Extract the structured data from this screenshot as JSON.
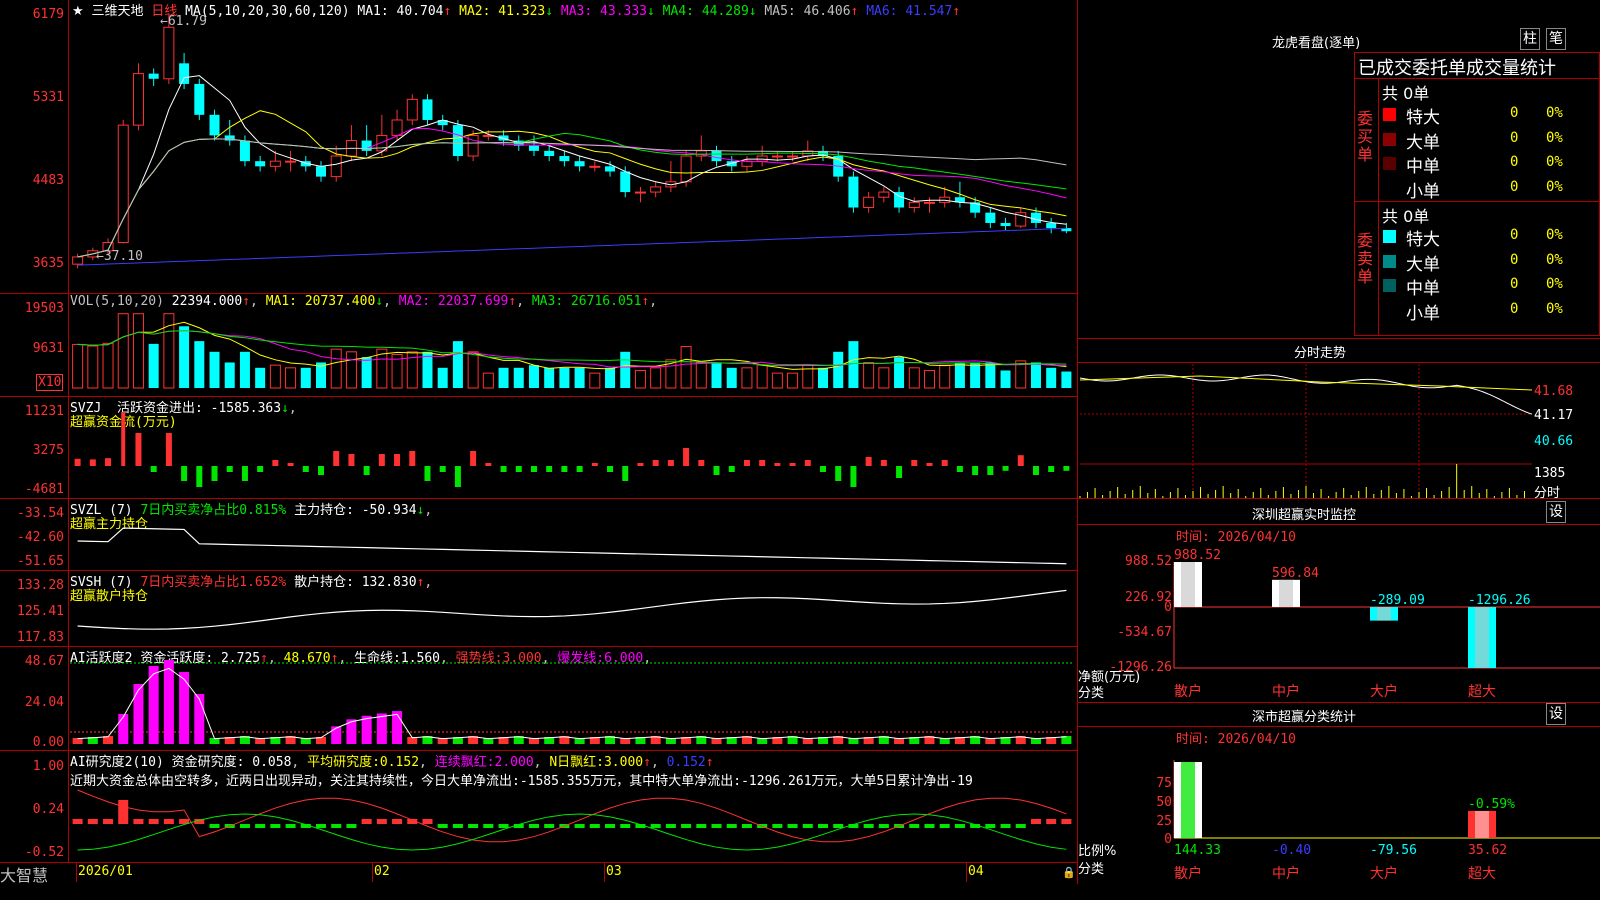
{
  "window": {
    "app_name": "大智慧"
  },
  "main": {
    "title": "三维天地",
    "period": "日线",
    "ma_label": "MA(5,10,20,30,60,120)",
    "ma": [
      {
        "label": "MA1:",
        "value": "40.704",
        "arrow": "↑",
        "color": "#ffffff"
      },
      {
        "label": "MA2:",
        "value": "41.323",
        "arrow": "↓",
        "color": "#ffff00"
      },
      {
        "label": "MA3:",
        "value": "43.333",
        "arrow": "↓",
        "color": "#ff00ff"
      },
      {
        "label": "MA4:",
        "value": "44.289",
        "arrow": "↓",
        "color": "#00e600"
      },
      {
        "label": "MA5:",
        "value": "46.406",
        "arrow": "↑",
        "color": "#c0c0c0"
      },
      {
        "label": "MA6:",
        "value": "41.547",
        "arrow": "↑",
        "color": "#3c3cff"
      }
    ],
    "high_note": "61.79",
    "low_note": "37.10",
    "y_ticks": [
      "6179",
      "5331",
      "4483",
      "3635"
    ],
    "x_ticks": [
      "2026/01",
      "02",
      "03",
      "04"
    ]
  },
  "vol": {
    "label": "VOL(5,10,20)",
    "value": "22394.000",
    "ma": [
      {
        "label": "MA1:",
        "value": "20737.400",
        "arrow": "↓",
        "color": "#ffff00"
      },
      {
        "label": "MA2:",
        "value": "22037.699",
        "arrow": "↑",
        "color": "#ff00ff"
      },
      {
        "label": "MA3:",
        "value": "26716.051",
        "arrow": "↑",
        "color": "#00e600"
      }
    ],
    "y_ticks": [
      "19503",
      "9631"
    ],
    "unit": "X10"
  },
  "svzj": {
    "label": "SVZJ",
    "desc": "活跃资金进出:",
    "value": "-1585.363",
    "sub": "超赢资金流(万元)",
    "y_ticks": [
      "11231",
      "3275",
      "-4681"
    ]
  },
  "svzl": {
    "label": "SVZL (7)",
    "desc1": "7日内买卖净占比0.815%",
    "desc2": "主力持仓:",
    "value": "-50.934",
    "sub": "超赢主力持仓",
    "y_ticks": [
      "-33.54",
      "-42.60",
      "-51.65"
    ]
  },
  "svsh": {
    "label": "SVSH (7)",
    "desc1": "7日内买卖净占比1.652%",
    "desc2": "散户持仓:",
    "value": "132.830",
    "sub": "超赢散户持仓",
    "y_ticks": [
      "133.28",
      "125.41",
      "117.83"
    ]
  },
  "ai1": {
    "label": "AI活跃度2",
    "desc": "资金活跃度:",
    "v1": "2.725",
    "v2": "48.670",
    "life_label": "生命线:",
    "life": "1.560",
    "strong_label": "强势线:",
    "strong": "3.000",
    "burst_label": "爆发线:",
    "burst": "6.000",
    "y_ticks": [
      "48.67",
      "24.04",
      "0.00"
    ]
  },
  "ai2": {
    "label": "AI研究度2(10)",
    "desc": "资金研究度:",
    "v1": "0.058",
    "avg_label": "平均研究度:",
    "avg": "0.152",
    "red_label": "连续飘红:",
    "red": "2.000",
    "n_label": "N日飘红:",
    "n": "3.000",
    "v5": "0.152",
    "text": "近期大资金总体由空转多，近两日出现异动，关注其持续性，今日大单净流出:-1585.355万元，其中特大单净流出:-1296.261万元，大单5日累计净出-19",
    "y_ticks": [
      "1.00",
      "0.24",
      "-0.52"
    ]
  },
  "longhu": {
    "title": "龙虎看盘(逐单)",
    "btn1": "柱",
    "btn2": "笔",
    "header": "已成交委托单成交量统计",
    "buy_label": "委买单",
    "sell_label": "委卖单",
    "buy_total": "共 0单",
    "sell_total": "共 0单",
    "buy_rows": [
      {
        "name": "特大",
        "qty": "0",
        "pct": "0%",
        "color": "#ff0000"
      },
      {
        "name": "大单",
        "qty": "0",
        "pct": "0%",
        "color": "#8b0000"
      },
      {
        "name": "中单",
        "qty": "0",
        "pct": "0%",
        "color": "#5a0000"
      },
      {
        "name": "小单",
        "qty": "0",
        "pct": "0%",
        "color": "#000000"
      }
    ],
    "sell_rows": [
      {
        "name": "特大",
        "qty": "0",
        "pct": "0%",
        "color": "#00ffff"
      },
      {
        "name": "大单",
        "qty": "0",
        "pct": "0%",
        "color": "#008b8b"
      },
      {
        "name": "中单",
        "qty": "0",
        "pct": "0%",
        "color": "#006060"
      },
      {
        "name": "小单",
        "qty": "0",
        "pct": "0%",
        "color": "#000000"
      }
    ]
  },
  "intraday": {
    "title": "分时走势",
    "y_ticks": [
      "41.68",
      "41.17",
      "40.66"
    ],
    "vol_tick": "1385",
    "vol_label": "分时"
  },
  "sz_monitor": {
    "title": "深圳超赢实时监控",
    "set": "设",
    "date": "时间: 2026/04/10",
    "y_ticks": [
      "988.52",
      "226.92",
      "0",
      "-534.67",
      "-1296.26"
    ],
    "ylabel": "净额(万元)",
    "xlabel": "分类",
    "categories": [
      "散户",
      "中户",
      "大户",
      "超大"
    ],
    "values": [
      988.52,
      596.84,
      -289.09,
      -1296.26
    ],
    "value_labels": [
      "988.52",
      "596.84",
      "-289.09",
      "-1296.26"
    ]
  },
  "sz_class": {
    "title": "深市超赢分类统计",
    "set": "设",
    "date": "时间: 2026/04/10",
    "y_ticks": [
      "75",
      "50",
      "25",
      "0"
    ],
    "ylabel": "比例%",
    "xlabel": "分类",
    "categories": [
      "散户",
      "中户",
      "大户",
      "超大"
    ],
    "values": [
      144.33,
      -0.4,
      -79.56,
      35.62
    ],
    "value_labels": [
      "144.33",
      "-0.40",
      "-79.56",
      "35.62"
    ],
    "top_note": "-0.59%"
  },
  "chart_data": [
    {
      "type": "candlestick",
      "title": "三维天地 日线",
      "ylim": [
        36.35,
        61.79
      ],
      "x": [
        "2026/01",
        "02",
        "03",
        "04"
      ],
      "candles": [
        [
          37.5,
          38.2,
          37.1,
          38.5
        ],
        [
          38.2,
          38.8,
          37.9,
          39.1
        ],
        [
          38.8,
          39.6,
          38.5,
          40.0
        ],
        [
          39.6,
          51.0,
          39.5,
          51.5
        ],
        [
          51.0,
          56.0,
          50.5,
          57.0
        ],
        [
          56.0,
          55.5,
          54.8,
          56.5
        ],
        [
          55.5,
          60.5,
          55.0,
          61.79
        ],
        [
          57.0,
          55.0,
          54.5,
          58.0
        ],
        [
          55.0,
          52.0,
          51.5,
          55.5
        ],
        [
          52.0,
          50.0,
          49.5,
          52.5
        ],
        [
          50.0,
          49.5,
          49.0,
          51.5
        ],
        [
          49.5,
          47.5,
          47.0,
          50.0
        ],
        [
          47.5,
          47.0,
          46.5,
          48.0
        ],
        [
          47.0,
          47.5,
          46.5,
          48.5
        ],
        [
          47.5,
          47.5,
          46.5,
          48.5
        ],
        [
          47.5,
          47.0,
          46.5,
          48.0
        ],
        [
          47.0,
          46.0,
          45.5,
          47.5
        ],
        [
          46.0,
          48.0,
          45.5,
          49.0
        ],
        [
          48.0,
          49.5,
          47.5,
          51.0
        ],
        [
          49.5,
          48.5,
          48.0,
          51.0
        ],
        [
          48.5,
          50.0,
          48.0,
          52.0
        ],
        [
          50.0,
          51.5,
          49.5,
          52.5
        ],
        [
          51.5,
          53.5,
          51.0,
          54.0
        ],
        [
          53.5,
          51.5,
          51.0,
          54.0
        ],
        [
          51.5,
          51.0,
          50.5,
          52.0
        ],
        [
          51.0,
          48.0,
          47.5,
          51.5
        ],
        [
          48.0,
          50.0,
          47.5,
          50.5
        ],
        [
          50.0,
          50.0,
          49.5,
          50.5
        ],
        [
          50.0,
          49.5,
          49.0,
          50.5
        ],
        [
          49.5,
          49.0,
          48.5,
          50.0
        ],
        [
          49.0,
          48.5,
          48.0,
          50.0
        ],
        [
          48.5,
          48.0,
          47.5,
          49.0
        ],
        [
          48.0,
          47.5,
          47.0,
          48.5
        ],
        [
          47.5,
          47.0,
          46.5,
          48.0
        ],
        [
          47.0,
          47.0,
          46.5,
          47.5
        ],
        [
          47.0,
          46.5,
          46.0,
          47.5
        ],
        [
          46.5,
          44.5,
          44.0,
          47.0
        ],
        [
          44.5,
          44.5,
          43.5,
          45.0
        ],
        [
          44.5,
          45.0,
          44.0,
          45.5
        ],
        [
          45.0,
          45.5,
          44.5,
          47.5
        ],
        [
          45.5,
          48.0,
          45.0,
          48.5
        ],
        [
          48.0,
          48.5,
          47.5,
          50.0
        ],
        [
          48.5,
          47.5,
          47.0,
          49.0
        ],
        [
          47.5,
          47.0,
          46.5,
          48.0
        ],
        [
          47.0,
          47.5,
          46.5,
          48.0
        ],
        [
          47.5,
          48.0,
          47.0,
          49.0
        ],
        [
          48.0,
          48.0,
          47.5,
          48.5
        ],
        [
          48.0,
          48.0,
          47.5,
          48.5
        ],
        [
          48.0,
          48.5,
          47.5,
          49.5
        ],
        [
          48.5,
          48.0,
          47.5,
          49.0
        ],
        [
          48.0,
          46.0,
          45.5,
          48.5
        ],
        [
          46.0,
          43.0,
          42.5,
          46.5
        ],
        [
          43.0,
          44.0,
          42.5,
          44.5
        ],
        [
          44.0,
          44.5,
          43.5,
          45.0
        ],
        [
          44.5,
          43.0,
          42.5,
          45.0
        ],
        [
          43.0,
          43.5,
          42.5,
          44.0
        ],
        [
          43.5,
          43.5,
          42.5,
          44.0
        ],
        [
          43.5,
          44.0,
          43.0,
          45.0
        ],
        [
          44.0,
          43.5,
          43.0,
          45.5
        ],
        [
          43.5,
          42.5,
          42.0,
          44.0
        ],
        [
          42.5,
          41.5,
          41.0,
          43.0
        ],
        [
          41.5,
          41.2,
          40.8,
          42.0
        ],
        [
          41.2,
          42.5,
          41.0,
          43.0
        ],
        [
          42.5,
          41.5,
          41.0,
          43.0
        ],
        [
          41.5,
          41.0,
          40.5,
          42.0
        ],
        [
          41.0,
          40.7,
          40.5,
          41.5
        ]
      ]
    },
    {
      "type": "bar",
      "title": "深圳超赢实时监控",
      "categories": [
        "散户",
        "中户",
        "大户",
        "超大"
      ],
      "values": [
        988.52,
        596.84,
        -289.09,
        -1296.26
      ],
      "ylabel": "净额(万元)",
      "xlabel": "分类"
    },
    {
      "type": "bar",
      "title": "深市超赢分类统计",
      "categories": [
        "散户",
        "中户",
        "大户",
        "超大"
      ],
      "values": [
        144.33,
        -0.4,
        -79.56,
        35.62
      ],
      "ylabel": "比例%",
      "xlabel": "分类"
    }
  ]
}
